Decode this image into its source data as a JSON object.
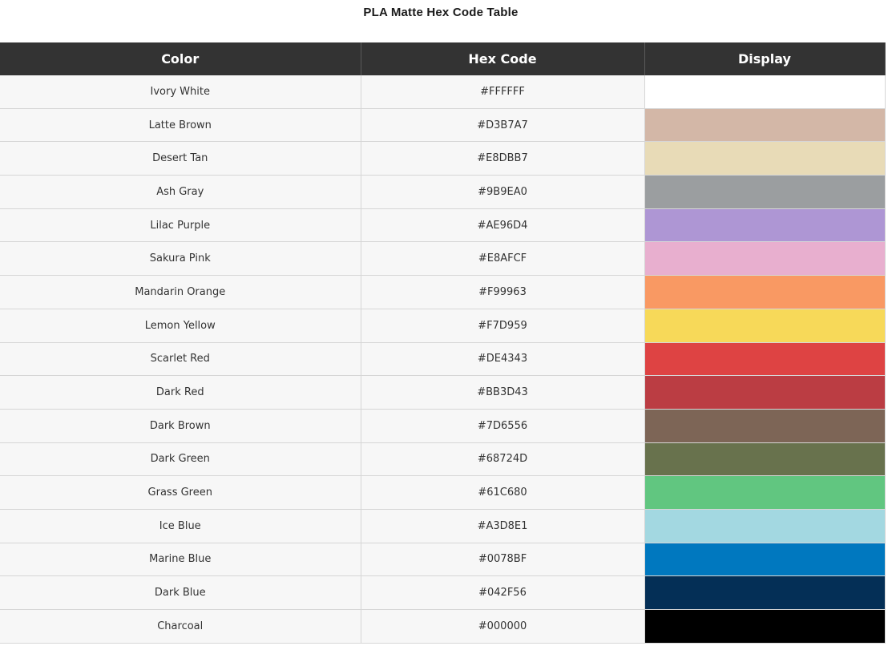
{
  "title": "PLA Matte Hex Code Table",
  "headers": {
    "color": "Color",
    "hex": "Hex Code",
    "display": "Display"
  },
  "rows": [
    {
      "name": "Ivory White",
      "hex": "#FFFFFF"
    },
    {
      "name": "Latte Brown",
      "hex": "#D3B7A7"
    },
    {
      "name": "Desert Tan",
      "hex": "#E8DBB7"
    },
    {
      "name": "Ash Gray",
      "hex": "#9B9EA0"
    },
    {
      "name": "Lilac Purple",
      "hex": "#AE96D4"
    },
    {
      "name": "Sakura Pink",
      "hex": "#E8AFCF"
    },
    {
      "name": "Mandarin Orange",
      "hex": "#F99963"
    },
    {
      "name": "Lemon Yellow",
      "hex": "#F7D959"
    },
    {
      "name": "Scarlet Red",
      "hex": "#DE4343"
    },
    {
      "name": "Dark Red",
      "hex": "#BB3D43"
    },
    {
      "name": "Dark Brown",
      "hex": "#7D6556"
    },
    {
      "name": "Dark Green",
      "hex": "#68724D"
    },
    {
      "name": "Grass Green",
      "hex": "#61C680"
    },
    {
      "name": "Ice Blue",
      "hex": "#A3D8E1"
    },
    {
      "name": "Marine Blue",
      "hex": "#0078BF"
    },
    {
      "name": "Dark Blue",
      "hex": "#042F56"
    },
    {
      "name": "Charcoal",
      "hex": "#000000"
    }
  ]
}
